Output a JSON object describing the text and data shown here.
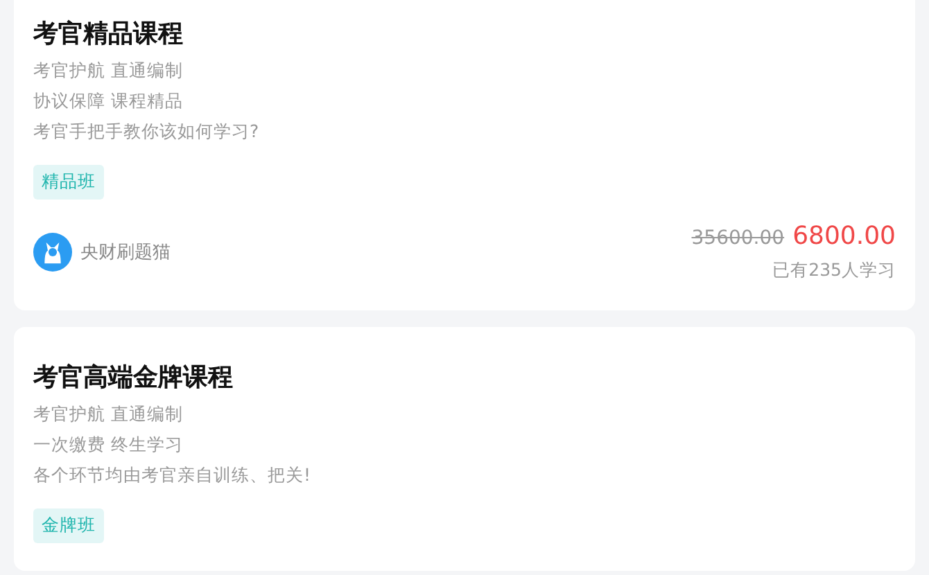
{
  "courses": [
    {
      "title": "考官精品课程",
      "lines": [
        "考官护航 直通编制",
        "协议保障 课程精品",
        "考官手把手教你该如何学习?"
      ],
      "tag": "精品班",
      "provider": "央财刷题猫",
      "original_price": "35600.00",
      "price": "6800.00",
      "learners": "已有235人学习"
    },
    {
      "title": "考官高端金牌课程",
      "lines": [
        "考官护航 直通编制",
        "一次缴费 终生学习",
        "各个环节均由考官亲自训练、把关!"
      ],
      "tag": "金牌班"
    }
  ]
}
